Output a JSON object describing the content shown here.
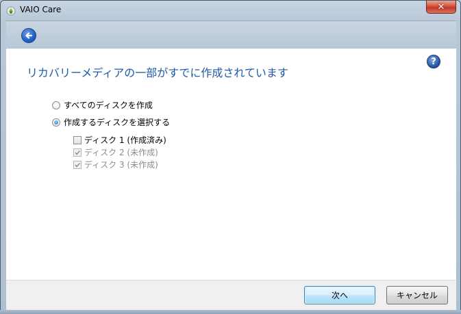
{
  "window": {
    "title": "VAIO Care",
    "close_label": "✕"
  },
  "nav": {
    "back_icon": "back-arrow-icon"
  },
  "content": {
    "heading": "リカバリーメディアの一部がすでに作成されています",
    "help_label": "?",
    "options": [
      {
        "label": "すべてのディスクを作成",
        "checked": false
      },
      {
        "label": "作成するディスクを選択する",
        "checked": true
      }
    ],
    "disks": [
      {
        "label": "ディスク 1 (作成済み)",
        "checked": false,
        "enabled": true
      },
      {
        "label": "ディスク 2 (未作成)",
        "checked": true,
        "enabled": false
      },
      {
        "label": "ディスク 3 (未作成)",
        "checked": true,
        "enabled": false
      }
    ]
  },
  "footer": {
    "next_label": "次へ",
    "cancel_label": "キャンセル"
  },
  "colors": {
    "heading": "#1e5aa8",
    "accent": "#1f5fc4",
    "close": "#c0392b"
  }
}
